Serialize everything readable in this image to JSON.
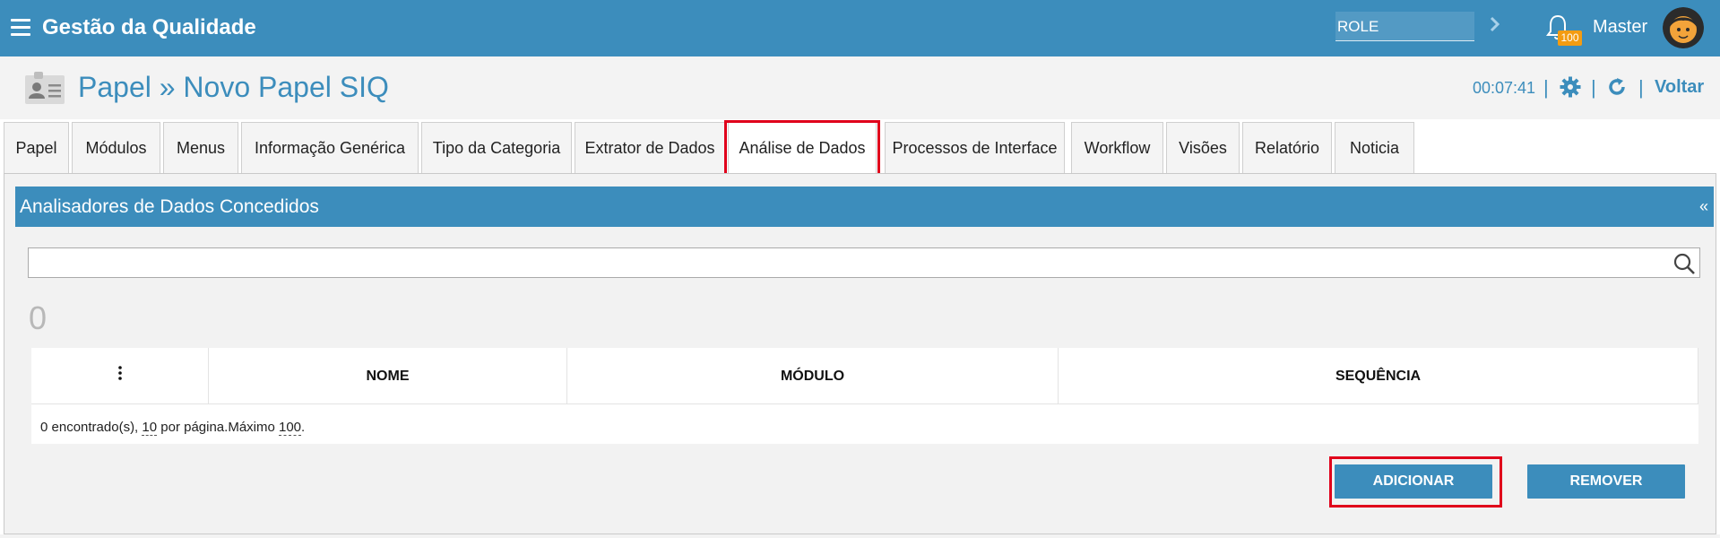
{
  "topbar": {
    "app_title": "Gestão da Qualidade",
    "role_value": "ROLE",
    "notification_count": "100",
    "user_name": "Master",
    "background_color": "#3c8dbc"
  },
  "page": {
    "title": "Papel » Novo Papel SIQ",
    "timer": "00:07:41",
    "back_label": "Voltar",
    "accent_color": "#3c8dbc"
  },
  "tabs": [
    {
      "label": "Papel"
    },
    {
      "label": "Módulos"
    },
    {
      "label": "Menus"
    },
    {
      "label": "Informação Genérica"
    },
    {
      "label": "Tipo da Categoria"
    },
    {
      "label": "Extrator de Dados"
    },
    {
      "label": "Análise de Dados",
      "active": true
    },
    {
      "label": "Processos de Interface"
    },
    {
      "label": "Workflow"
    },
    {
      "label": "Visões"
    },
    {
      "label": "Relatório"
    },
    {
      "label": "Noticia"
    }
  ],
  "panel": {
    "title": "Analisadores de Dados Concedidos",
    "collapse_symbol": "«",
    "search_value": "",
    "result_count": "0",
    "columns": [
      "NOME",
      "MÓDULO",
      "SEQUÊNCIA"
    ],
    "footer": {
      "found": "0 encontrado(s), ",
      "per_page_value": "10",
      "per_page_text": " por página.Máximo ",
      "max_value": "100",
      "end": "."
    },
    "add_button": "ADICIONAR",
    "remove_button": "REMOVER"
  },
  "icons": {
    "menu": "hamburger-menu-icon",
    "role_arrow": "chevron-right-icon",
    "bell": "bell-icon",
    "avatar": "user-avatar",
    "page": "id-card-icon",
    "gear": "gear-icon",
    "refresh": "refresh-icon",
    "search": "search-icon",
    "column_menu": "vertical-ellipsis-icon"
  },
  "highlight_color": "#e0001b"
}
